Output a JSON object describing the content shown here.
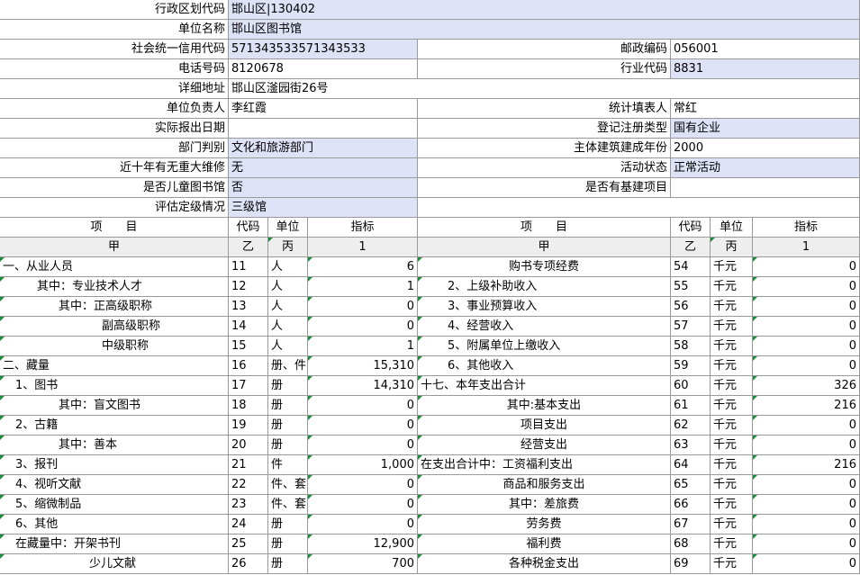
{
  "meta": [
    {
      "label": "行政区划代码",
      "value": "邯山区|130402"
    },
    {
      "label": "单位名称",
      "value": "邯山区图书馆"
    },
    {
      "label": "社会统一信用代码",
      "value": "571343533571343533",
      "label2": "邮政编码",
      "value2": "056001"
    },
    {
      "label": "电话号码",
      "value": "8120678",
      "label2": "行业代码",
      "value2": "8831"
    },
    {
      "label": "详细地址",
      "value": "邯山区滏园街26号"
    },
    {
      "label": "单位负责人",
      "value": "李红霞",
      "label2": "统计填表人",
      "value2": "常红"
    },
    {
      "label": "实际报出日期",
      "value": "",
      "label2": "登记注册类型",
      "value2": "国有企业"
    },
    {
      "label": "部门判别",
      "value": "文化和旅游部门",
      "label2": "主体建筑建成年份",
      "value2": "2000"
    },
    {
      "label": "近十年有无重大维修",
      "value": "无",
      "label2": "活动状态",
      "value2": "正常活动"
    },
    {
      "label": "是否儿童图书馆",
      "value": "否",
      "label2": "是否有基建项目",
      "value2": ""
    },
    {
      "label": "评估定级情况",
      "value": "三级馆"
    }
  ],
  "table_header": {
    "item": "项　　目",
    "code": "代码",
    "unit": "单位",
    "indicator": "指标",
    "item_sub": "甲",
    "code_sub": "乙",
    "unit_sub": "丙",
    "indicator_sub": "1"
  },
  "left_rows": [
    {
      "item": "一、从业人员",
      "code": "11",
      "unit": "人",
      "value": "6"
    },
    {
      "item": "其中：专业技术人才",
      "code": "12",
      "unit": "人",
      "value": "1"
    },
    {
      "item": "其中：正高级职称",
      "code": "13",
      "unit": "人",
      "value": "0"
    },
    {
      "item": "副高级职称",
      "code": "14",
      "unit": "人",
      "value": "0"
    },
    {
      "item": "中级职称",
      "code": "15",
      "unit": "人",
      "value": "1"
    },
    {
      "item": "二、藏量",
      "code": "16",
      "unit": "册、件",
      "value": "15,310"
    },
    {
      "item": "1、图书",
      "code": "17",
      "unit": "册",
      "value": "14,310"
    },
    {
      "item": "其中：盲文图书",
      "code": "18",
      "unit": "册",
      "value": "0"
    },
    {
      "item": "2、古籍",
      "code": "19",
      "unit": "册",
      "value": "0"
    },
    {
      "item": "其中：善本",
      "code": "20",
      "unit": "册",
      "value": "0"
    },
    {
      "item": "3、报刊",
      "code": "21",
      "unit": "件",
      "value": "1,000"
    },
    {
      "item": "4、视听文献",
      "code": "22",
      "unit": "件、套",
      "value": "0"
    },
    {
      "item": "5、缩微制品",
      "code": "23",
      "unit": "件、套",
      "value": "0"
    },
    {
      "item": "6、其他",
      "code": "24",
      "unit": "册",
      "value": "0"
    },
    {
      "item": "在藏量中：开架书刊",
      "code": "25",
      "unit": "册",
      "value": "12,900"
    },
    {
      "item": "少儿文献",
      "code": "26",
      "unit": "册",
      "value": "700"
    }
  ],
  "right_rows": [
    {
      "item": "购书专项经费",
      "code": "54",
      "unit": "千元",
      "value": "0"
    },
    {
      "item": "2、上级补助收入",
      "code": "55",
      "unit": "千元",
      "value": "0"
    },
    {
      "item": "3、事业预算收入",
      "code": "56",
      "unit": "千元",
      "value": "0"
    },
    {
      "item": "4、经营收入",
      "code": "57",
      "unit": "千元",
      "value": "0"
    },
    {
      "item": "5、附属单位上缴收入",
      "code": "58",
      "unit": "千元",
      "value": "0"
    },
    {
      "item": "6、其他收入",
      "code": "59",
      "unit": "千元",
      "value": "0"
    },
    {
      "item": "十七、本年支出合计",
      "code": "60",
      "unit": "千元",
      "value": "326"
    },
    {
      "item": "其中:基本支出",
      "code": "61",
      "unit": "千元",
      "value": "216"
    },
    {
      "item": "项目支出",
      "code": "62",
      "unit": "千元",
      "value": "0"
    },
    {
      "item": "经营支出",
      "code": "63",
      "unit": "千元",
      "value": "0"
    },
    {
      "item": "在支出合计中：工资福利支出",
      "code": "64",
      "unit": "千元",
      "value": "216"
    },
    {
      "item": "商品和服务支出",
      "code": "65",
      "unit": "千元",
      "value": "0"
    },
    {
      "item": "其中：差旅费",
      "code": "66",
      "unit": "千元",
      "value": "0"
    },
    {
      "item": "劳务费",
      "code": "67",
      "unit": "千元",
      "value": "0"
    },
    {
      "item": "福利费",
      "code": "68",
      "unit": "千元",
      "value": "0"
    },
    {
      "item": "各种税金支出",
      "code": "69",
      "unit": "千元",
      "value": "0"
    }
  ]
}
